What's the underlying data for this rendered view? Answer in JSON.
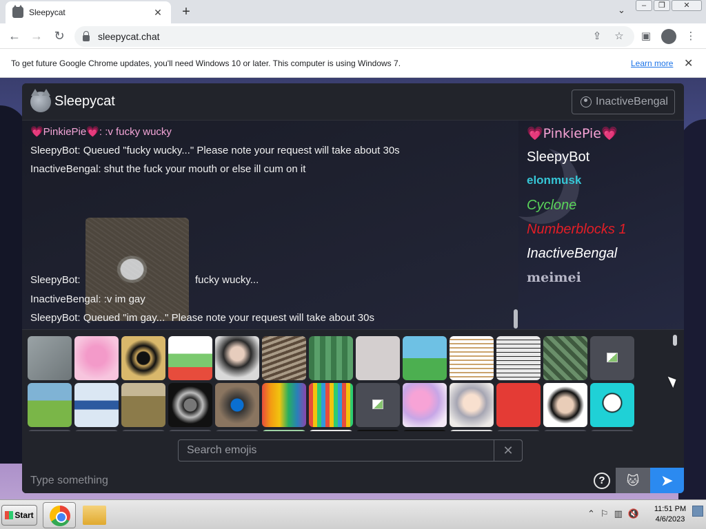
{
  "browser": {
    "tab_title": "Sleepycat",
    "url": "sleepycat.chat",
    "infobar_message": "To get future Google Chrome updates, you'll need Windows 10 or later. This computer is using Windows 7.",
    "infobar_link": "Learn more"
  },
  "app": {
    "name": "Sleepycat",
    "current_user": "InactiveBengal",
    "messages": [
      {
        "text": "💗PinkiePie💗: :v fucky wucky",
        "color": "#f4a6d8"
      },
      {
        "text": "SleepyBot: Queued \"fucky wucky...\" Please note your request will take about 30s",
        "color": "#f1f1f1"
      },
      {
        "text": "InactiveBengal: shut the fuck your mouth or else ill cum on it",
        "color": "#f1f1f1"
      },
      {
        "text": "SleepyBot:",
        "color": "#f1f1f1"
      },
      {
        "text": "fucky wucky...",
        "color": "#f1f1f1"
      },
      {
        "text": "InactiveBengal: :v im gay",
        "color": "#f1f1f1"
      },
      {
        "text": "SleepyBot: Queued \"im gay...\" Please note your request will take about 30s",
        "color": "#f1f1f1"
      }
    ],
    "users": [
      {
        "name": "💗PinkiePie💗",
        "color": "#f7a3d6"
      },
      {
        "name": "SleepyBot",
        "color": "#ffffff"
      },
      {
        "name": "elonmusk",
        "color": "#36c6d6"
      },
      {
        "name": "Cyclone",
        "color": "#5ad45a"
      },
      {
        "name": "Numberblocks 1",
        "color": "#e41e26"
      },
      {
        "name": "InactiveBengal",
        "color": "#ffffff"
      },
      {
        "name": "meimei",
        "color": "#b7b7c7"
      }
    ],
    "emoji_search_placeholder": "Search emojis",
    "emoji_clear": "✕",
    "message_placeholder": "Type something",
    "help_label": "?",
    "cat_icon": "🐱",
    "send_icon": "➤"
  },
  "taskbar": {
    "start_label": "Start",
    "time": "11:51 PM",
    "date": "4/6/2023"
  }
}
